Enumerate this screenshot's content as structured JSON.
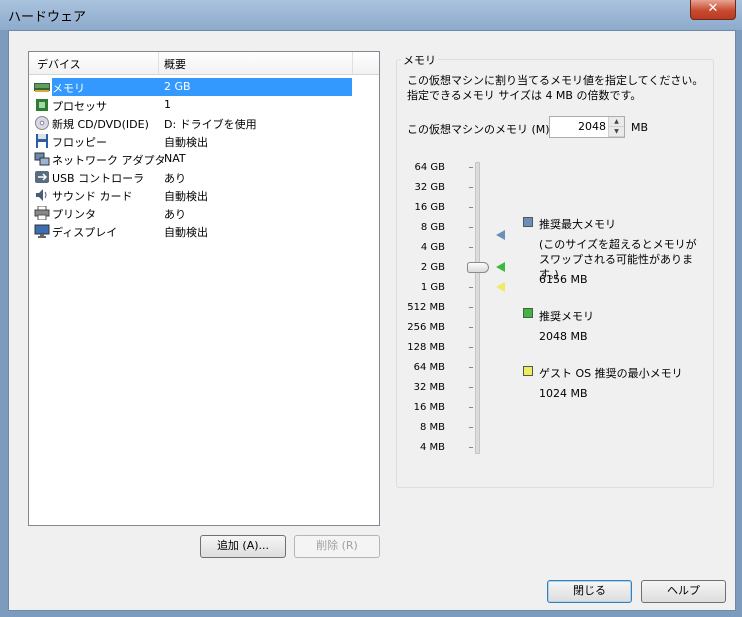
{
  "window": {
    "title": "ハードウェア",
    "close_glyph": "✕"
  },
  "device_list": {
    "headers": {
      "device": "デバイス",
      "summary": "概要"
    },
    "rows": [
      {
        "name": "メモリ",
        "summary": "2 GB",
        "icon": "memory-icon",
        "selected": true
      },
      {
        "name": "プロセッサ",
        "summary": "1",
        "icon": "processor-icon"
      },
      {
        "name": "新規 CD/DVD(IDE)",
        "summary": "D: ドライブを使用",
        "icon": "cd-dvd-icon"
      },
      {
        "name": "フロッピー",
        "summary": "自動検出",
        "icon": "floppy-icon"
      },
      {
        "name": "ネットワーク アダプタ",
        "summary": "NAT",
        "icon": "network-adapter-icon"
      },
      {
        "name": "USB コントローラ",
        "summary": "あり",
        "icon": "usb-icon"
      },
      {
        "name": "サウンド カード",
        "summary": "自動検出",
        "icon": "sound-card-icon"
      },
      {
        "name": "プリンタ",
        "summary": "あり",
        "icon": "printer-icon"
      },
      {
        "name": "ディスプレイ",
        "summary": "自動検出",
        "icon": "display-icon"
      }
    ]
  },
  "buttons": {
    "add": "追加 (A)...",
    "remove": "削除 (R)",
    "close": "閉じる",
    "help": "ヘルプ"
  },
  "memory": {
    "group_label": "メモリ",
    "description": "この仮想マシンに割り当てるメモリ値を指定してください。指定できるメモリ サイズは 4 MB の倍数です。",
    "field_label": "この仮想マシンのメモリ (M):",
    "value": "2048",
    "unit": "MB",
    "scale": [
      "64 GB",
      "32 GB",
      "16 GB",
      "8 GB",
      "4 GB",
      "2 GB",
      "1 GB",
      "512 MB",
      "256 MB",
      "128 MB",
      "64 MB",
      "32 MB",
      "16 MB",
      "8 MB",
      "4 MB"
    ],
    "slider_value": "2 GB",
    "legend": [
      {
        "label": "推奨最大メモリ",
        "note": "(このサイズを超えるとメモリがスワップされる可能性があります。)",
        "value": "6156 MB",
        "color": "#6b8fb8"
      },
      {
        "label": "推奨メモリ",
        "value": "2048 MB",
        "color": "#3cb83c"
      },
      {
        "label": "ゲスト OS 推奨の最小メモリ",
        "value": "1024 MB",
        "color": "#ecec60"
      }
    ]
  }
}
